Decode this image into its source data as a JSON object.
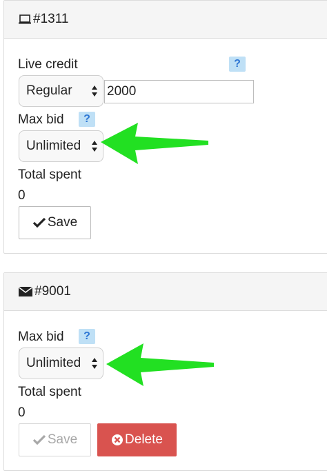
{
  "panels": [
    {
      "id_label": "#1311",
      "icon": "laptop-icon",
      "live_credit_label": "Live credit",
      "help_text": "?",
      "credit_type_value": "Regular",
      "credit_amount_value": "2000",
      "max_bid_label": "Max bid",
      "max_bid_value": "Unlimited",
      "total_spent_label": "Total spent",
      "total_spent_value": "0",
      "save_label": "Save"
    },
    {
      "id_label": "#9001",
      "icon": "envelope-icon",
      "help_text": "?",
      "max_bid_label": "Max bid",
      "max_bid_value": "Unlimited",
      "total_spent_label": "Total spent",
      "total_spent_value": "0",
      "save_label": "Save",
      "delete_label": "Delete"
    }
  ],
  "colors": {
    "annotation_arrow": "#22e022",
    "help_badge_bg": "#bfe0f6",
    "delete_button_bg": "#d9534f"
  }
}
